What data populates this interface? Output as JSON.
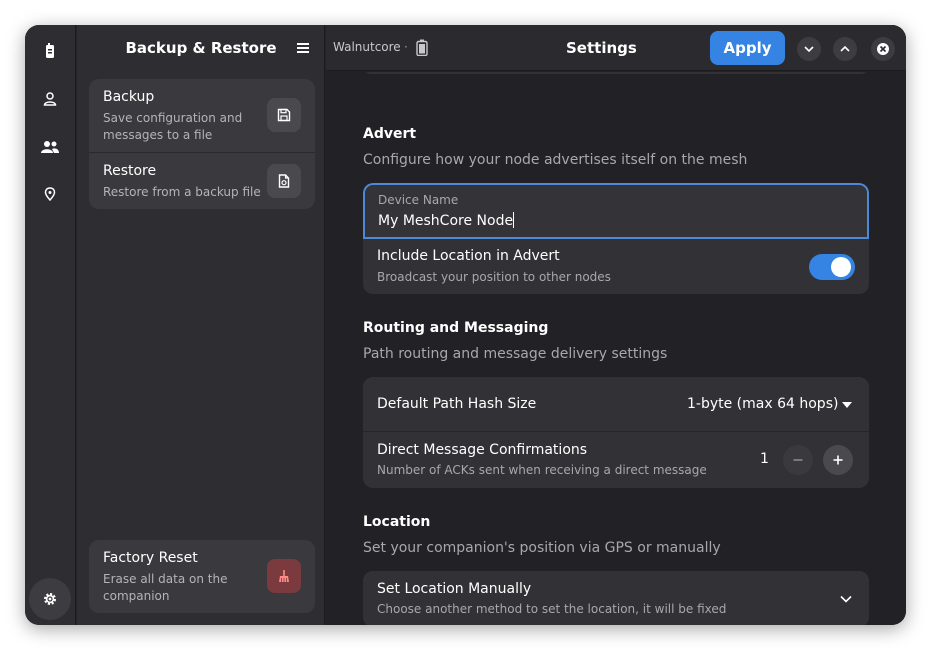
{
  "sidebar": {
    "title": "Backup & Restore",
    "items": [
      {
        "title": "Backup",
        "subtitle": "Save configuration and messages to a file"
      },
      {
        "title": "Restore",
        "subtitle": "Restore from a backup file"
      }
    ],
    "factory_reset": {
      "title": "Factory Reset",
      "subtitle": "Erase all data on the companion"
    }
  },
  "topbar": {
    "device_name": "Walnutcore",
    "separator": "·",
    "title": "Settings",
    "apply_label": "Apply"
  },
  "advert": {
    "title": "Advert",
    "subtitle": "Configure how your node advertises itself on the mesh",
    "device_name_label": "Device Name",
    "device_name_value": "My MeshCore Node",
    "include_location_title": "Include Location in Advert",
    "include_location_subtitle": "Broadcast your position to other nodes",
    "include_location_enabled": true
  },
  "routing": {
    "title": "Routing and Messaging",
    "subtitle": "Path routing and message delivery settings",
    "path_hash_label": "Default Path Hash Size",
    "path_hash_value": "1-byte (max 64 hops)",
    "dm_confirm_title": "Direct Message Confirmations",
    "dm_confirm_subtitle": "Number of ACKs sent when receiving a direct message",
    "dm_confirm_value": "1"
  },
  "location": {
    "title": "Location",
    "subtitle": "Set your companion's position via GPS or manually",
    "manual_title": "Set Location Manually",
    "manual_subtitle": "Choose another method to set the location, it will be fixed"
  },
  "colors": {
    "accent": "#3584e4",
    "danger": "#7a3a3e",
    "window_bg": "#222226",
    "sidebar_bg": "#2e2e32"
  },
  "icons": {
    "rail": [
      "radio-device-icon",
      "person-icon",
      "people-icon",
      "location-pin-icon",
      "gear-icon"
    ],
    "backup": "save-icon",
    "restore": "file-restore-icon",
    "factory_reset": "broom-icon"
  }
}
